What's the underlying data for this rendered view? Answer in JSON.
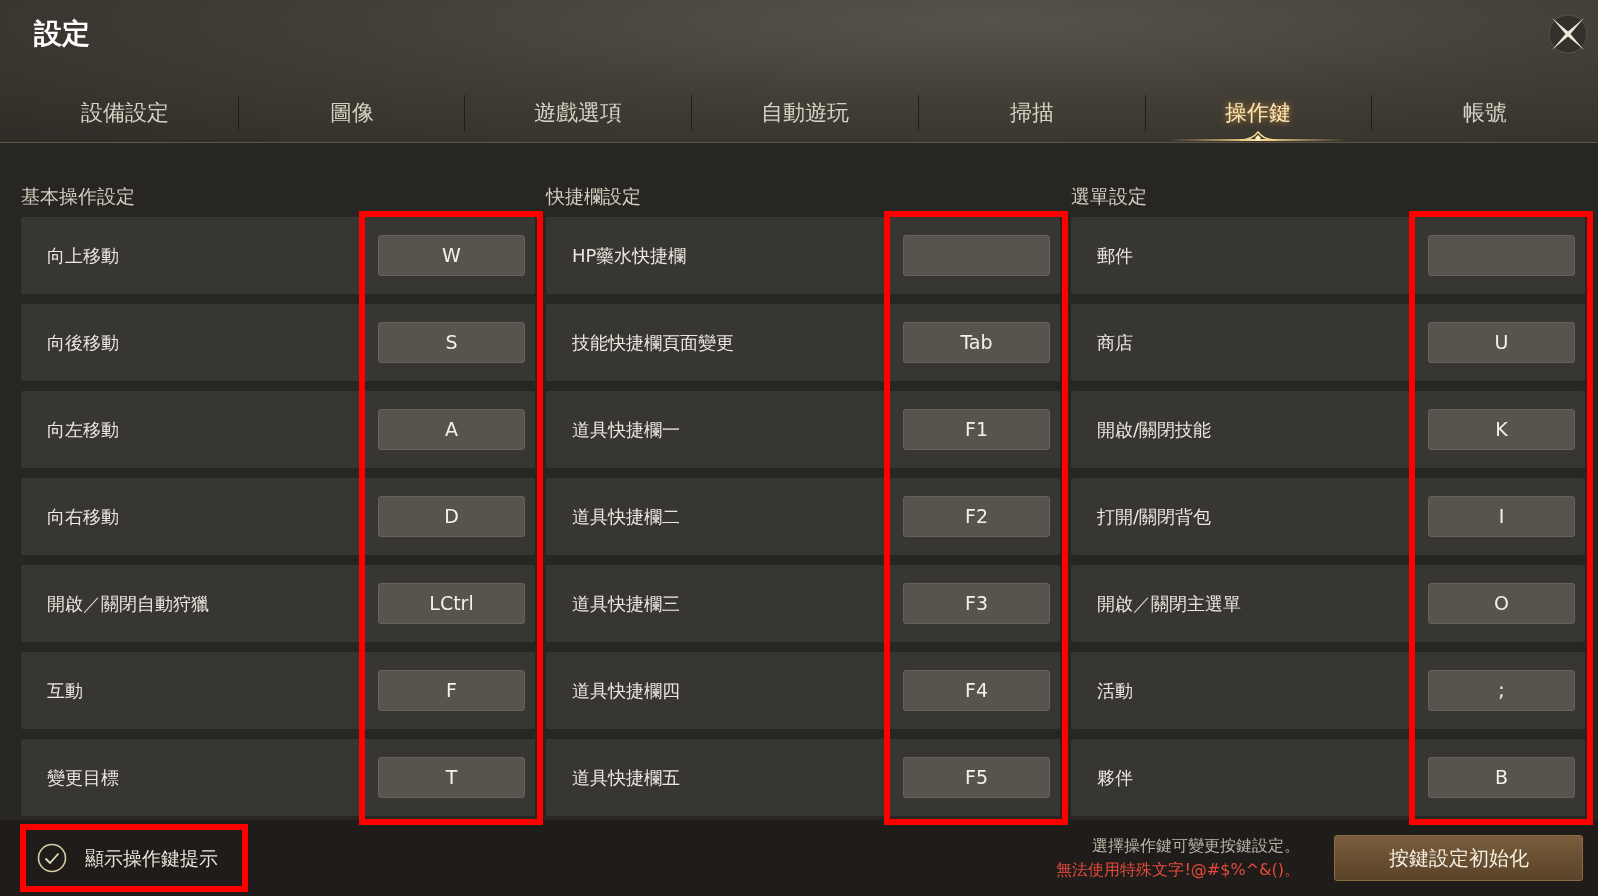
{
  "window": {
    "title": "設定"
  },
  "tabs": [
    {
      "label": "設備設定",
      "selected": false
    },
    {
      "label": "圖像",
      "selected": false
    },
    {
      "label": "遊戲選項",
      "selected": false
    },
    {
      "label": "自動遊玩",
      "selected": false
    },
    {
      "label": "掃描",
      "selected": false
    },
    {
      "label": "操作鍵",
      "selected": true
    },
    {
      "label": "帳號",
      "selected": false
    }
  ],
  "columns": [
    {
      "heading": "基本操作設定",
      "keys_highlighted": true,
      "rows": [
        {
          "action": "向上移動",
          "key": "W"
        },
        {
          "action": "向後移動",
          "key": "S"
        },
        {
          "action": "向左移動",
          "key": "A"
        },
        {
          "action": "向右移動",
          "key": "D"
        },
        {
          "action": "開啟／關閉自動狩獵",
          "key": "LCtrl"
        },
        {
          "action": "互動",
          "key": "F"
        },
        {
          "action": "變更目標",
          "key": "T"
        }
      ]
    },
    {
      "heading": "快捷欄設定",
      "keys_highlighted": true,
      "rows": [
        {
          "action": "HP藥水快捷欄"
        },
        {
          "action": "技能快捷欄頁面變更",
          "key": "Tab"
        },
        {
          "action": "道具快捷欄一",
          "key": "F1"
        },
        {
          "action": "道具快捷欄二",
          "key": "F2"
        },
        {
          "action": "道具快捷欄三",
          "key": "F3"
        },
        {
          "action": "道具快捷欄四",
          "key": "F4"
        },
        {
          "action": "道具快捷欄五",
          "key": "F5"
        }
      ]
    },
    {
      "heading": "選單設定",
      "keys_highlighted": true,
      "rows": [
        {
          "action": "郵件"
        },
        {
          "action": "商店",
          "key": "U"
        },
        {
          "action": "開啟/關閉技能",
          "key": "K"
        },
        {
          "action": "打開/關閉背包",
          "key": "I"
        },
        {
          "action": "開啟／關閉主選單",
          "key": "O"
        },
        {
          "action": "活動",
          "key": ";"
        },
        {
          "action": "夥伴",
          "key": "B"
        }
      ]
    }
  ],
  "footer": {
    "show_key_hints": {
      "label": "顯示操作鍵提示",
      "checked": true,
      "highlighted": true
    },
    "hint": "選擇操作鍵可變更按鍵設定。",
    "warning": "無法使用特殊文字!@#$%^&()。",
    "reset_button": "按鍵設定初始化"
  }
}
